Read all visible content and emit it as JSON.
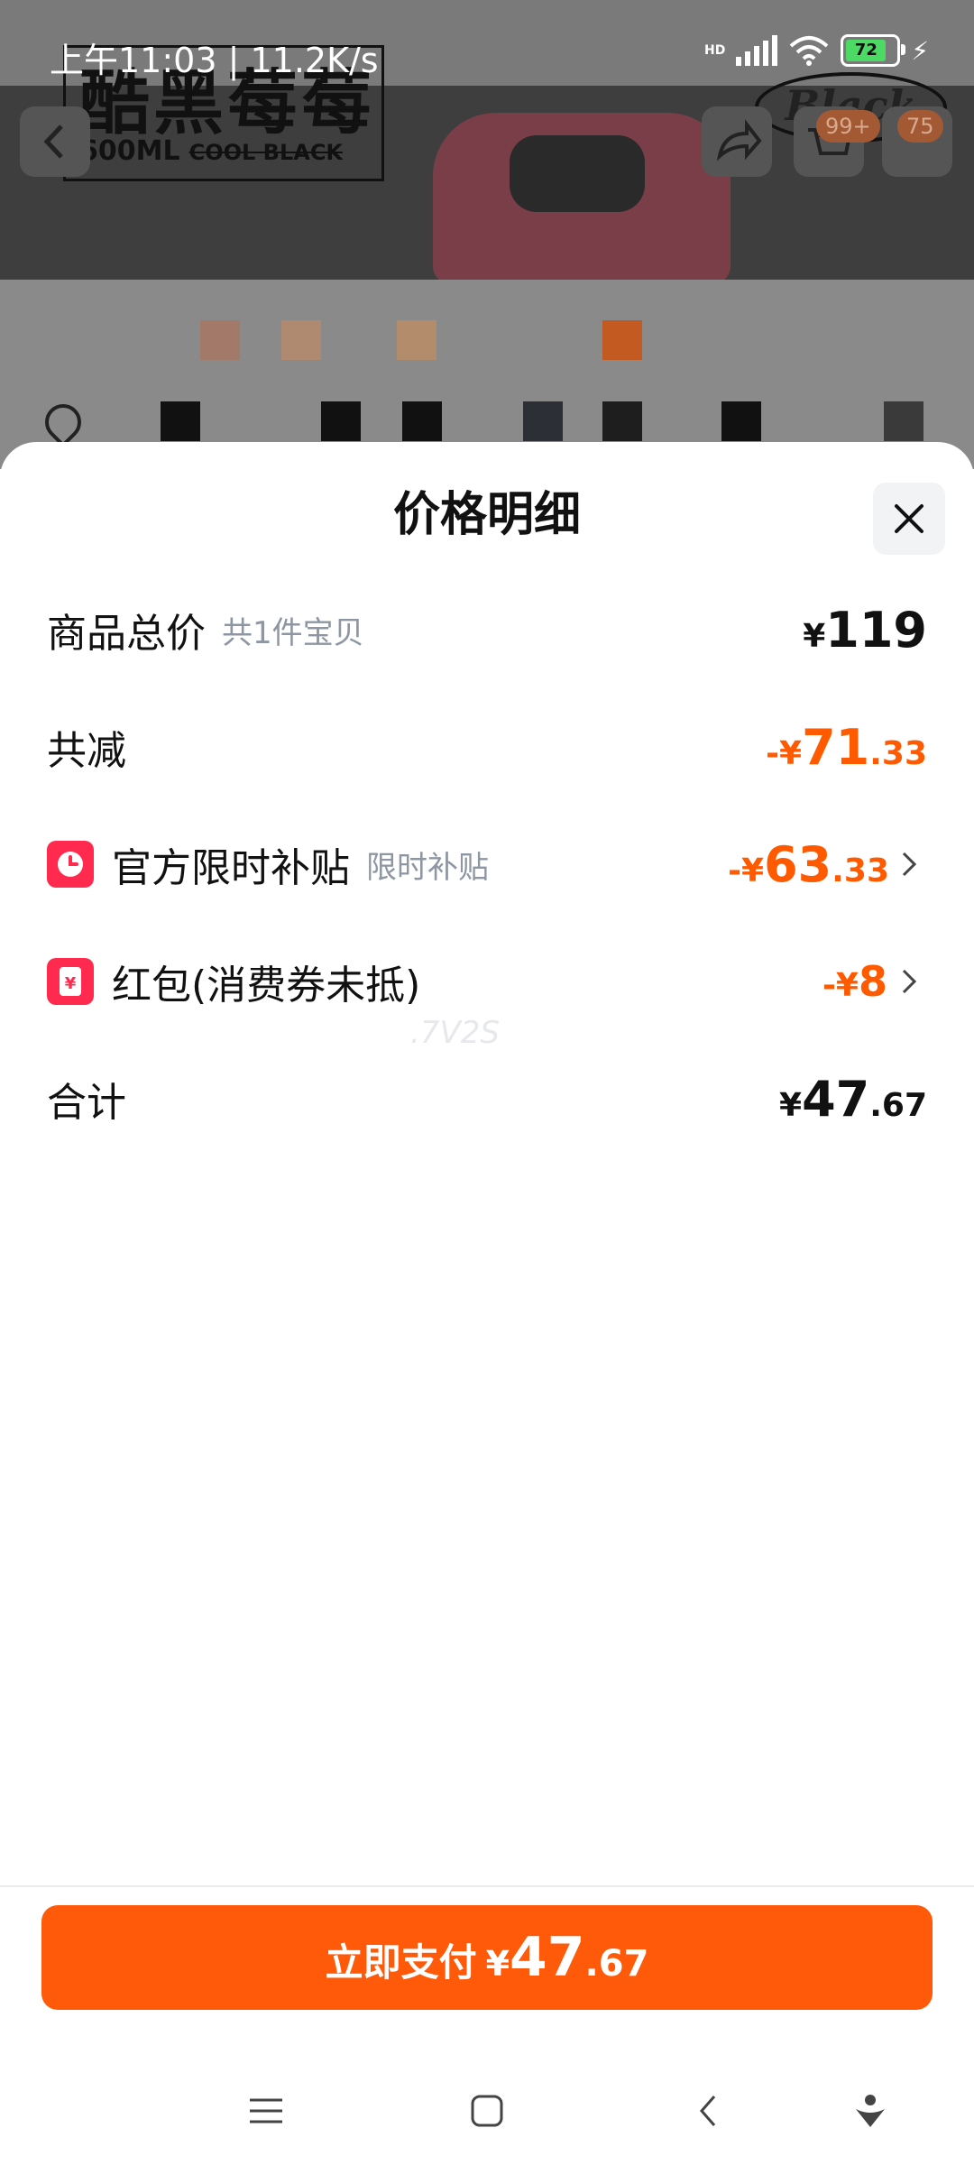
{
  "status_bar": {
    "time": "上午11:03 | 11.2K/s",
    "network_label": "HD",
    "battery": "72"
  },
  "background": {
    "brand_title": "酷黑莓莓",
    "brand_volume": "600ML",
    "brand_tag": "COOL BLACK",
    "logo_text": "Black",
    "cart_badge": "99+",
    "message_badge": "75"
  },
  "sheet": {
    "title": "价格明细",
    "rows": [
      {
        "label": "商品总价",
        "hint": "共1件宝贝",
        "currency": "¥",
        "int": "119",
        "dec": ""
      },
      {
        "label": "共减",
        "hint": "",
        "currency": "-¥",
        "int": "71",
        "dec": ".33"
      },
      {
        "label": "官方限时补贴",
        "hint": "限时补贴",
        "currency": "-¥",
        "int": "63",
        "dec": ".33"
      },
      {
        "label": "红包(消费券未抵)",
        "hint": "",
        "currency": "-¥",
        "int": "8",
        "dec": ""
      },
      {
        "label": "合计",
        "hint": "",
        "currency": "¥",
        "int": "47",
        "dec": ".67"
      }
    ],
    "watermark": ".7V2S"
  },
  "pay_button": {
    "label": "立即支付",
    "currency": "¥",
    "int": "47",
    "dec": ".67"
  },
  "colors": {
    "accent": "#ff5a0a",
    "discount": "#ff5a00",
    "coupon_icon": "#ff2a4d"
  },
  "icons": {
    "close": "close-icon",
    "subsidy": "clock-icon",
    "coupon": "yen-coupon-icon",
    "chevron": "chevron-right-icon"
  }
}
